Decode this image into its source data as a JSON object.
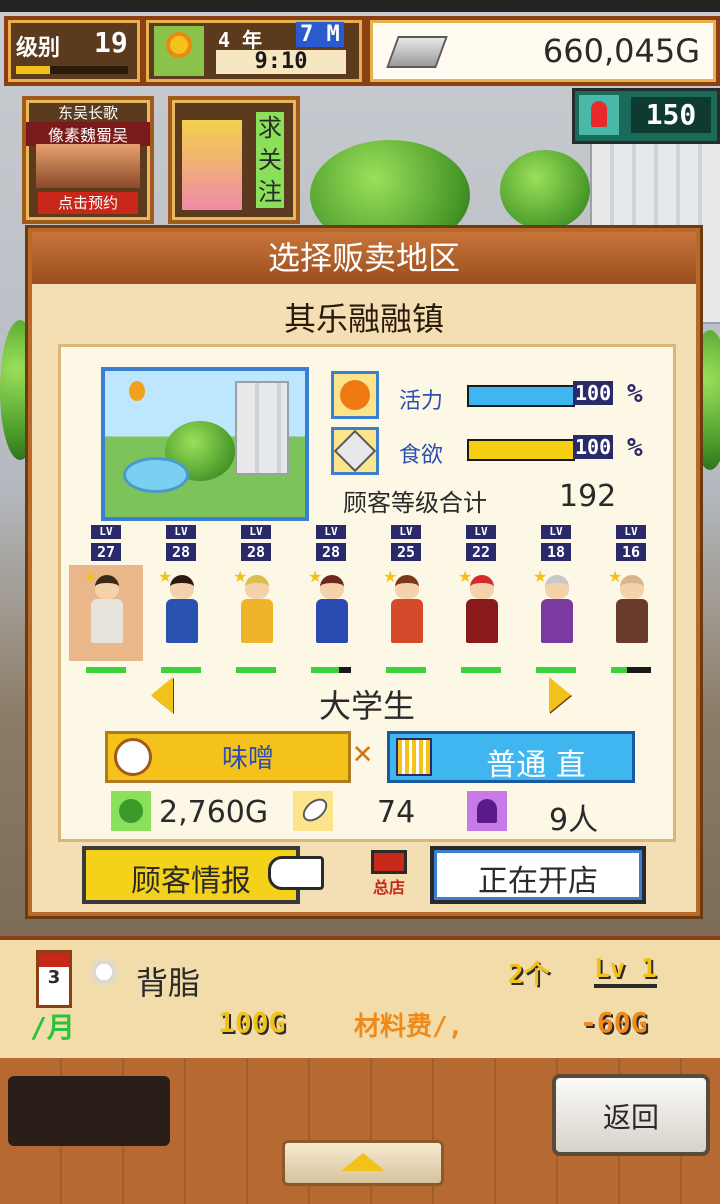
{
  "hud": {
    "rank_label": "级别",
    "rank_value": "19",
    "date_year": "4 年",
    "date_month": "7 M",
    "time": "9:10",
    "money": "660,045G",
    "research_points": "150"
  },
  "banners": {
    "ad_title_line1": "东吴长歌",
    "ad_title_line2": "像素魏蜀吴",
    "ad_button": "点击预约",
    "follow_label": "求关注"
  },
  "dialog": {
    "title": "选择贩卖地区",
    "town_name": "其乐融融镇",
    "stats": [
      {
        "label": "活力",
        "value": "100",
        "unit": "%",
        "fill": 1.0,
        "color": "#3fb6f0"
      },
      {
        "label": "食欲",
        "value": "100",
        "unit": "%",
        "fill": 1.0,
        "color": "#f5cf12"
      }
    ],
    "customer_level_label": "顾客等级合计",
    "customer_level_total": "192",
    "customers": [
      {
        "lv": "27",
        "hp": 1.0,
        "selected": true,
        "hair": "#3a2a1a",
        "body": "#e8e2dc"
      },
      {
        "lv": "28",
        "hp": 1.0,
        "selected": false,
        "hair": "#2a1a10",
        "body": "#2a52b0"
      },
      {
        "lv": "28",
        "hp": 1.0,
        "selected": false,
        "hair": "#d9c04a",
        "body": "#f0b42a"
      },
      {
        "lv": "28",
        "hp": 0.7,
        "selected": false,
        "hair": "#6a2a1a",
        "body": "#2a4ab0"
      },
      {
        "lv": "25",
        "hp": 1.0,
        "selected": false,
        "hair": "#7a3a1a",
        "body": "#d44a2a"
      },
      {
        "lv": "22",
        "hp": 1.0,
        "selected": false,
        "hair": "#d42a2a",
        "body": "#8a1a1a"
      },
      {
        "lv": "18",
        "hp": 1.0,
        "selected": false,
        "hair": "#c8c8c8",
        "body": "#7a3aa0"
      },
      {
        "lv": "16",
        "hp": 0.4,
        "selected": false,
        "hair": "#d8b48a",
        "body": "#6a3a2a"
      }
    ],
    "customer_type": "大学生",
    "taste_label": "味噌",
    "style_label": "普通 直",
    "price": "2,760G",
    "appeal": "74",
    "population": "9人",
    "info_button": "顾客情报",
    "shop_label": "总店",
    "open_button": "正在开店"
  },
  "bottom": {
    "item_name": "背脂",
    "item_slot": "3",
    "count": "2个",
    "level": "Lv 1",
    "per_month": "/月",
    "price": "100G",
    "material_label": "材料费/,",
    "material_cost": "-60G",
    "back_button": "返回"
  }
}
